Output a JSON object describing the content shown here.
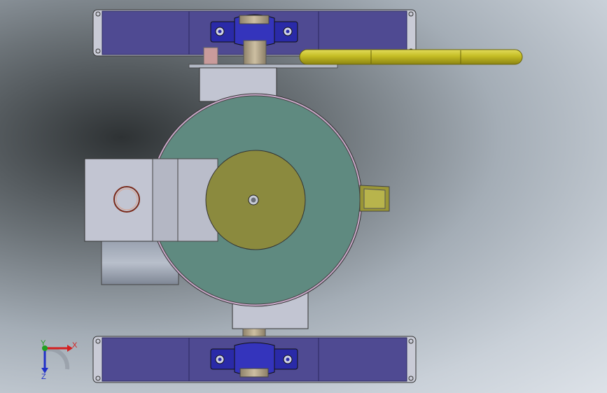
{
  "viewport": {
    "background_colors": [
      "#2e3234",
      "#a4adb6",
      "#dde2e8"
    ]
  },
  "colors": {
    "frame_blue": "#4f4a92",
    "bearing_blue": "#2a2aa8",
    "disk_teal": "#5f8a80",
    "hub_olive": "#8b8a3e",
    "rod_yellow": "#b8b01c",
    "shaft_tan": "#b4a486",
    "housing_gray": "#c2c5d2"
  },
  "triad": {
    "x_label": "X",
    "y_label": "Y",
    "z_label": "Z",
    "x_color": "#d42020",
    "y_color": "#20a020",
    "z_color": "#2030c8"
  }
}
